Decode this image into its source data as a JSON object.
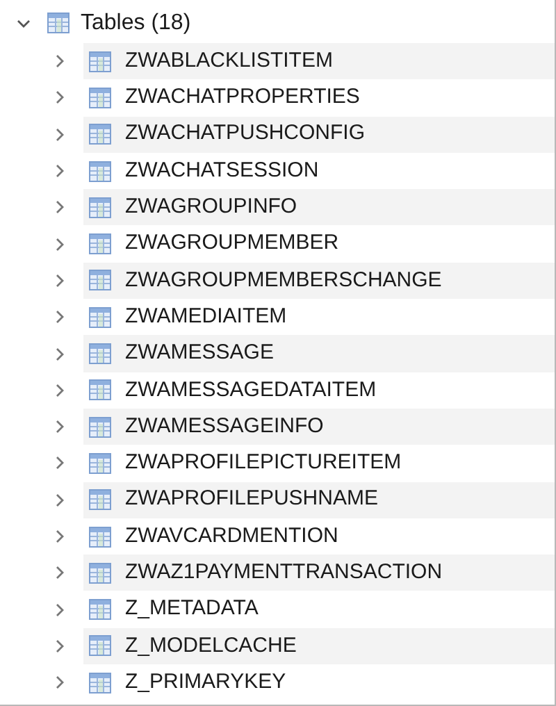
{
  "tree": {
    "label": "Tables (18)",
    "expanded": true,
    "children": [
      {
        "label": "ZWABLACKLISTITEM",
        "expanded": false
      },
      {
        "label": "ZWACHATPROPERTIES",
        "expanded": false
      },
      {
        "label": "ZWACHATPUSHCONFIG",
        "expanded": false
      },
      {
        "label": "ZWACHATSESSION",
        "expanded": false
      },
      {
        "label": "ZWAGROUPINFO",
        "expanded": false
      },
      {
        "label": "ZWAGROUPMEMBER",
        "expanded": false
      },
      {
        "label": "ZWAGROUPMEMBERSCHANGE",
        "expanded": false
      },
      {
        "label": "ZWAMEDIAITEM",
        "expanded": false
      },
      {
        "label": "ZWAMESSAGE",
        "expanded": false
      },
      {
        "label": "ZWAMESSAGEDATAITEM",
        "expanded": false
      },
      {
        "label": "ZWAMESSAGEINFO",
        "expanded": false
      },
      {
        "label": "ZWAPROFILEPICTUREITEM",
        "expanded": false
      },
      {
        "label": "ZWAPROFILEPUSHNAME",
        "expanded": false
      },
      {
        "label": "ZWAVCARDMENTION",
        "expanded": false
      },
      {
        "label": "ZWAZ1PAYMENTTRANSACTION",
        "expanded": false
      },
      {
        "label": "Z_METADATA",
        "expanded": false
      },
      {
        "label": "Z_MODELCACHE",
        "expanded": false
      },
      {
        "label": "Z_PRIMARYKEY",
        "expanded": false
      }
    ]
  }
}
